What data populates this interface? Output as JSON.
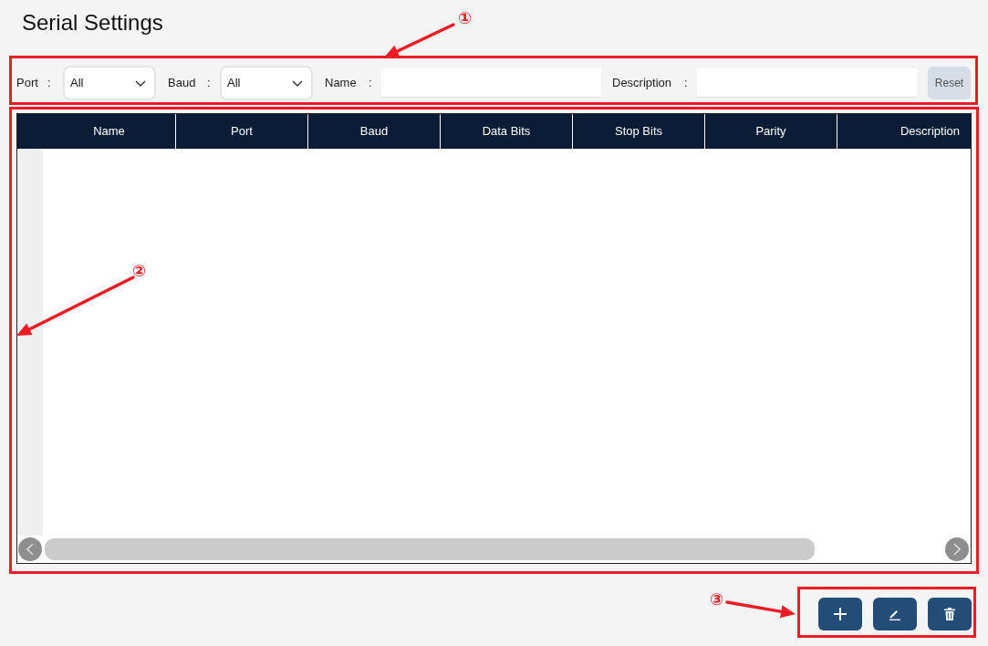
{
  "page": {
    "title": "Serial Settings"
  },
  "filters": [
    {
      "kind": "select",
      "label": "Port",
      "separator": ":",
      "value": "All"
    },
    {
      "kind": "select",
      "label": "Baud",
      "separator": ":",
      "value": "All"
    },
    {
      "kind": "text",
      "label": "Name",
      "separator": ":"
    },
    {
      "kind": "text",
      "label": "Description",
      "separator": ":"
    }
  ],
  "reset_button": {
    "label": "Reset"
  },
  "table": {
    "columns": [
      "Name",
      "Port",
      "Baud",
      "Data Bits",
      "Stop Bits",
      "Parity",
      "Description"
    ]
  },
  "actions": [
    {
      "kind": "add"
    },
    {
      "kind": "edit"
    },
    {
      "kind": "delete"
    }
  ],
  "annotations": [
    {
      "label": "①"
    },
    {
      "label": "②"
    },
    {
      "label": "③"
    }
  ]
}
